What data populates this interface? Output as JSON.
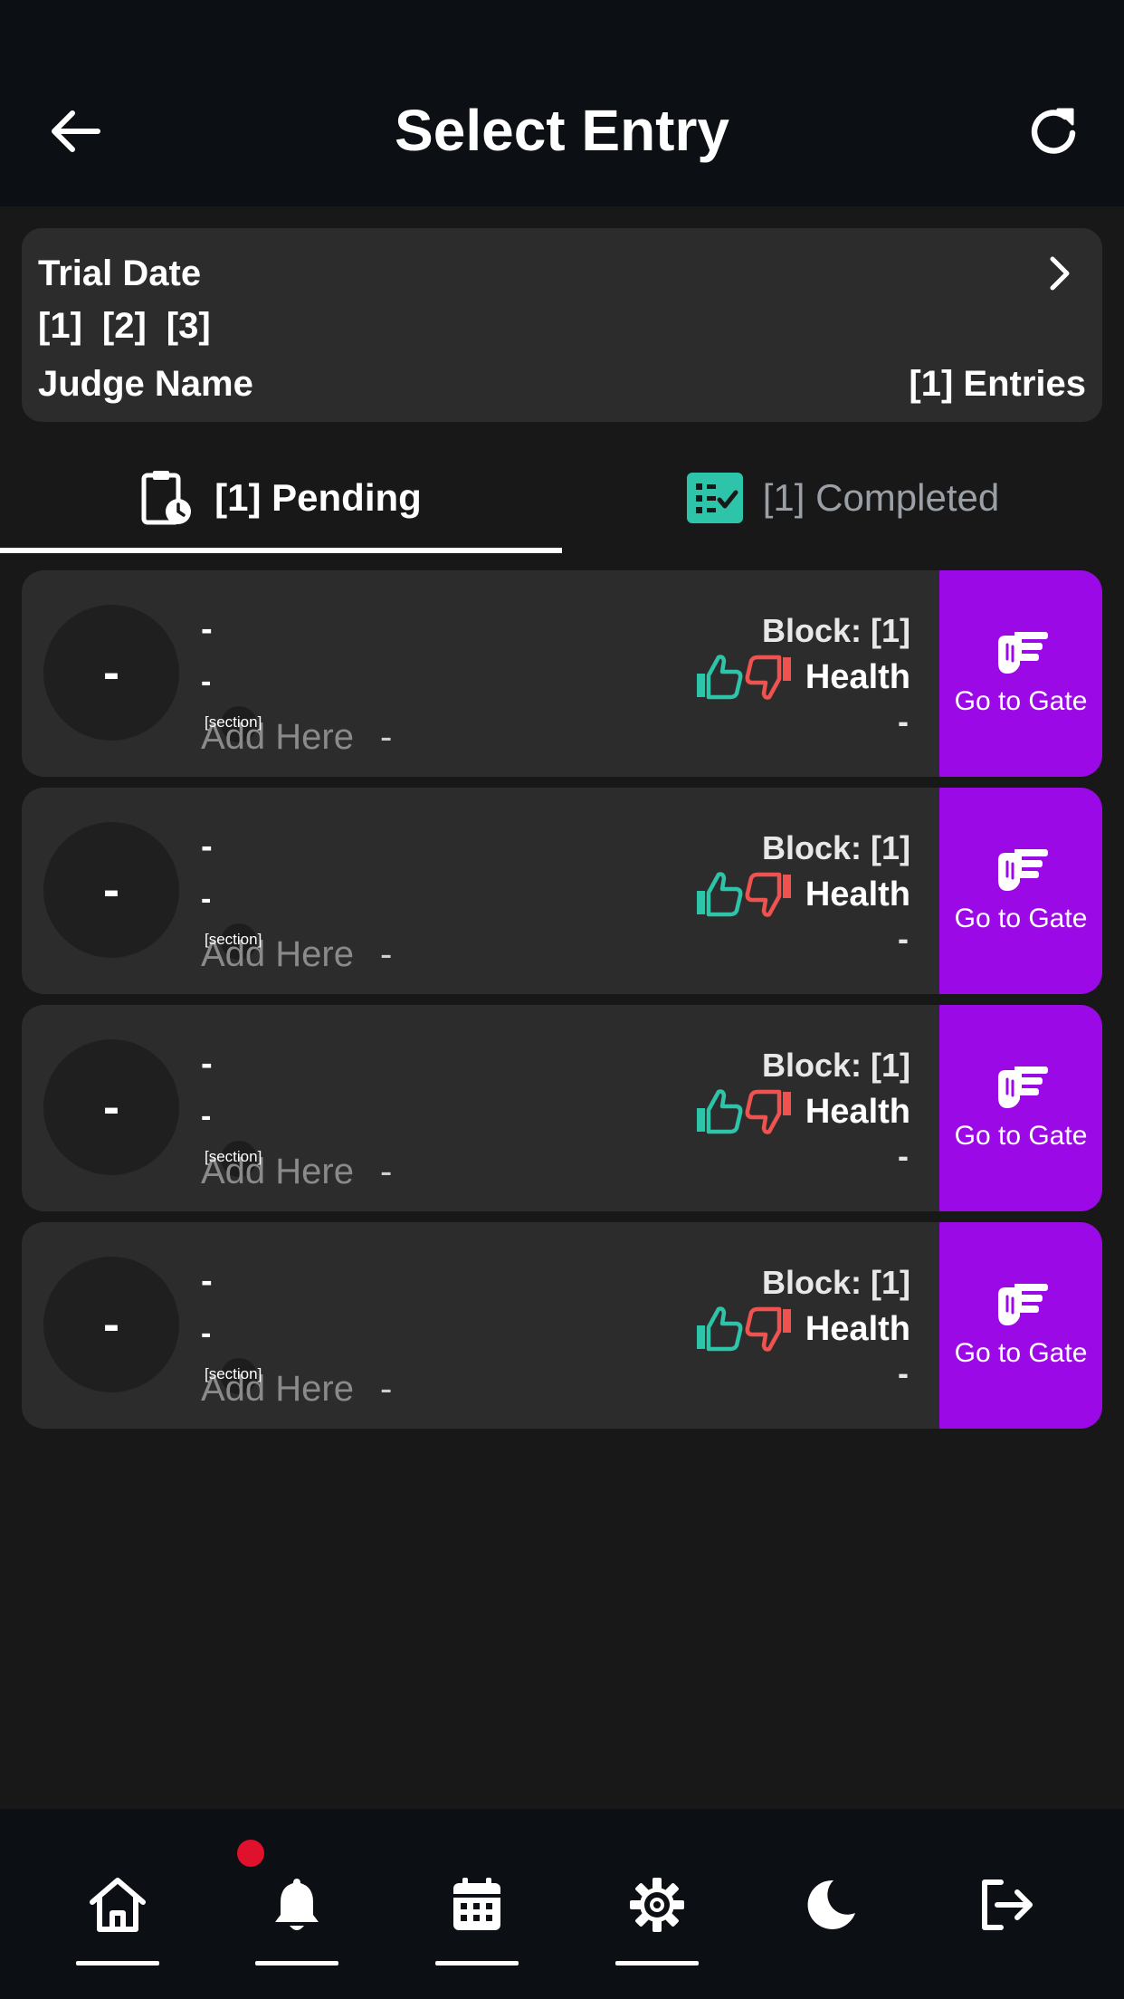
{
  "header": {
    "title": "Select Entry"
  },
  "trial": {
    "title": "Trial Date",
    "numbers": [
      "[1]",
      "[2]",
      "[3]"
    ],
    "judge": "Judge Name",
    "entries": "[1] Entries"
  },
  "tabs": {
    "pending": "[1] Pending",
    "completed": "[1] Completed",
    "completed_color": "#2ec4a9"
  },
  "entries": [
    {
      "avatar": "-",
      "name": "-",
      "sub": "-",
      "section": "[section]",
      "add_here": "Add Here",
      "dash": "-",
      "block": "Block: [1]",
      "health": "Health",
      "status": "-",
      "gate": "Go to Gate"
    },
    {
      "avatar": "-",
      "name": "-",
      "sub": "-",
      "section": "[section]",
      "add_here": "Add Here",
      "dash": "-",
      "block": "Block: [1]",
      "health": "Health",
      "status": "-",
      "gate": "Go to Gate"
    },
    {
      "avatar": "-",
      "name": "-",
      "sub": "-",
      "section": "[section]",
      "add_here": "Add Here",
      "dash": "-",
      "block": "Block: [1]",
      "health": "Health",
      "status": "-",
      "gate": "Go to Gate"
    },
    {
      "avatar": "-",
      "name": "-",
      "sub": "-",
      "section": "[section]",
      "add_here": "Add Here",
      "dash": "-",
      "block": "Block: [1]",
      "health": "Health",
      "status": "-",
      "gate": "Go to Gate"
    }
  ],
  "colors": {
    "accent": "#9b0ae6",
    "thumbs_up": "#2ec4a9",
    "thumbs_down": "#ef5350",
    "notification": "#e0112c"
  },
  "nav": [
    "home-icon",
    "bell-icon",
    "calendar-icon",
    "gear-icon",
    "moon-icon",
    "logout-icon"
  ]
}
